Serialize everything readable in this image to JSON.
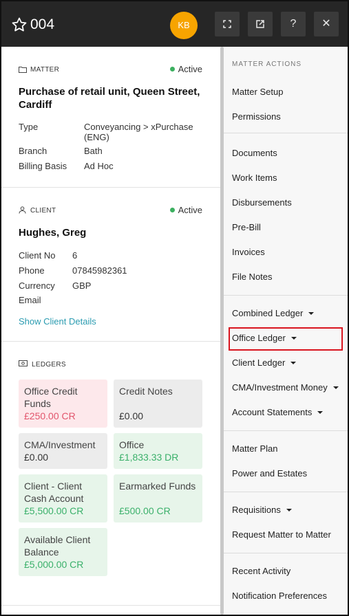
{
  "header": {
    "title": "004",
    "avatar_initials": "KB",
    "icons": [
      "star-icon",
      "expand-icon",
      "open-external-icon",
      "help-icon",
      "close-icon"
    ],
    "help_glyph": "?",
    "close_glyph": "✕"
  },
  "matter": {
    "section_label": "MATTER",
    "status": "Active",
    "title": "Purchase of retail unit, Queen Street, Cardiff",
    "fields": [
      {
        "key": "Type",
        "value": "Conveyancing > xPurchase (ENG)"
      },
      {
        "key": "Branch",
        "value": "Bath"
      },
      {
        "key": "Billing Basis",
        "value": "Ad Hoc"
      }
    ]
  },
  "client": {
    "section_label": "CLIENT",
    "status": "Active",
    "name": "Hughes, Greg",
    "fields": [
      {
        "key": "Client No",
        "value": "6"
      },
      {
        "key": "Phone",
        "value": "07845982361"
      },
      {
        "key": "Currency",
        "value": "GBP"
      },
      {
        "key": "Email",
        "value": ""
      }
    ],
    "details_link": "Show Client Details"
  },
  "ledgers": {
    "section_label": "LEDGERS",
    "cards": [
      {
        "label": "Office Credit Funds",
        "amount": "£250.00 CR",
        "tone": "red"
      },
      {
        "label": "Credit Notes",
        "amount": "£0.00",
        "tone": "grey"
      },
      {
        "label": "CMA/Investment",
        "amount": "£0.00",
        "tone": "grey"
      },
      {
        "label": "Office",
        "amount": "£1,833.33 DR",
        "tone": "green"
      },
      {
        "label": "Client - Client Cash Account",
        "amount": "£5,500.00 CR",
        "tone": "green"
      },
      {
        "label": "Earmarked Funds",
        "amount": "£500.00 CR",
        "tone": "green"
      },
      {
        "label": "Available Client Balance",
        "amount": "£5,000.00 CR",
        "tone": "green"
      }
    ]
  },
  "actions": {
    "title": "MATTER ACTIONS",
    "groups": [
      [
        {
          "label": "Matter Setup"
        },
        {
          "label": "Permissions"
        }
      ],
      [
        {
          "label": "Documents"
        },
        {
          "label": "Work Items"
        },
        {
          "label": "Disbursements"
        },
        {
          "label": "Pre-Bill"
        },
        {
          "label": "Invoices"
        },
        {
          "label": "File Notes"
        }
      ],
      [
        {
          "label": "Combined Ledger",
          "dropdown": true
        },
        {
          "label": "Office Ledger",
          "dropdown": true,
          "highlighted": true
        },
        {
          "label": "Client Ledger",
          "dropdown": true
        },
        {
          "label": "CMA/Investment Money",
          "dropdown": true
        },
        {
          "label": "Account Statements",
          "dropdown": true
        }
      ],
      [
        {
          "label": "Matter Plan"
        },
        {
          "label": "Power and Estates"
        }
      ],
      [
        {
          "label": "Requisitions",
          "dropdown": true
        },
        {
          "label": "Request Matter to Matter"
        }
      ],
      [
        {
          "label": "Recent Activity"
        },
        {
          "label": "Notification Preferences"
        }
      ]
    ]
  },
  "colors": {
    "header_bg": "#262626",
    "avatar": "#f7a400",
    "active_dot": "#3cb060",
    "link": "#2a9bb0",
    "highlight_border": "#d9141e"
  }
}
